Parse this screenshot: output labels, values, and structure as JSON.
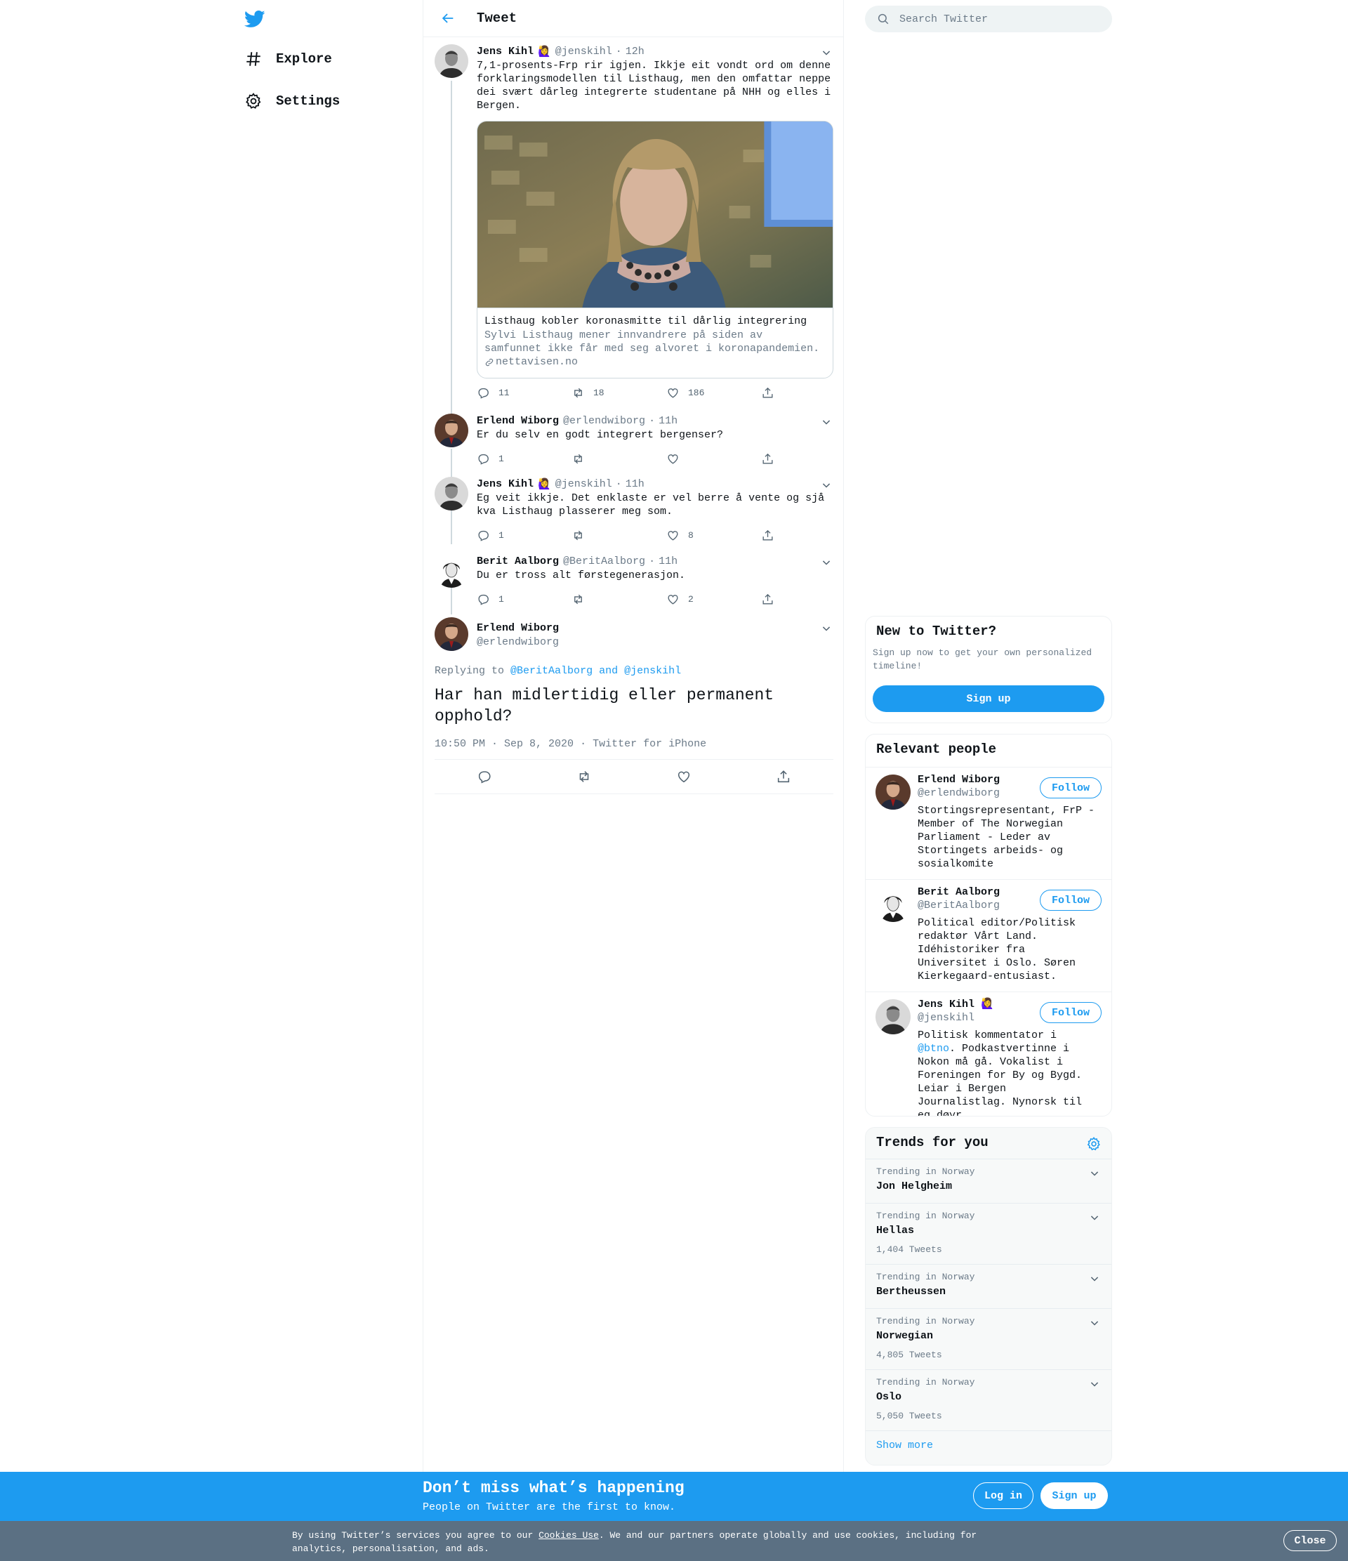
{
  "nav": {
    "logo": "twitter-bird-icon",
    "items": [
      {
        "label": "Explore",
        "icon": "hashtag-icon"
      },
      {
        "label": "Settings",
        "icon": "gear-icon"
      }
    ]
  },
  "header": {
    "title": "Tweet",
    "back_icon": "arrow-left-icon"
  },
  "thread": [
    {
      "name": "Jens Kihl",
      "emoji": "🙋‍♀️",
      "handle": "@jenskihl",
      "time": "12h",
      "text": "7,1-prosents-Frp rir igjen. Ikkje eit vondt ord om denne forklaringsmodellen til Listhaug, men den omfattar neppe dei svært dårleg integrerte studentane på NHH og elles i Bergen.",
      "card": {
        "title": "Listhaug kobler koronasmitte til dårlig integrering",
        "description": "Sylvi Listhaug mener innvandrere på siden av samfunnet ikke får med seg alvoret i koronapandemien. Lishaug …",
        "domain": "nettavisen.no"
      },
      "replies": "11",
      "retweets": "18",
      "likes": "186"
    },
    {
      "name": "Erlend Wiborg",
      "handle": "@erlendwiborg",
      "time": "11h",
      "text": "Er du selv en godt integrert bergenser?",
      "replies": "1",
      "retweets": "",
      "likes": ""
    },
    {
      "name": "Jens Kihl",
      "emoji": "🙋‍♀️",
      "handle": "@jenskihl",
      "time": "11h",
      "text": "Eg veit ikkje. Det enklaste er vel berre å vente og sjå kva Listhaug plasserer meg som.",
      "replies": "1",
      "retweets": "",
      "likes": "8"
    },
    {
      "name": "Berit Aalborg",
      "handle": "@BeritAalborg",
      "time": "11h",
      "text": "Du er tross alt førstegenerasjon.",
      "replies": "1",
      "retweets": "",
      "likes": "2"
    }
  ],
  "focus": {
    "name": "Erlend Wiborg",
    "handle": "@erlendwiborg",
    "replying_prefix": "Replying to",
    "replying_to": "@BeritAalborg and @jenskihl",
    "text": "Har han midlertidig eller permanent opphold?",
    "time": "10:50 PM",
    "date": "Sep 8, 2020",
    "source": "Twitter for iPhone"
  },
  "search": {
    "placeholder": "Search Twitter"
  },
  "new_to_twitter": {
    "title": "New to Twitter?",
    "text": "Sign up now to get your own personalized timeline!",
    "button": "Sign up"
  },
  "relevant": {
    "title": "Relevant people",
    "follow_label": "Follow",
    "people": [
      {
        "name": "Erlend Wiborg",
        "handle": "@erlendwiborg",
        "bio": "Stortingsrepresentant, FrP - Member of The Norwegian Parliament - Leder av Stortingets arbeids- og sosialkomite"
      },
      {
        "name": "Berit Aalborg",
        "handle": "@BeritAalborg",
        "bio": "Political editor/Politisk redaktør Vårt Land. Idéhistoriker fra Universitet i Oslo. Søren Kierkegaard-entusiast."
      },
      {
        "name": "Jens Kihl",
        "emoji": "🙋‍♀️",
        "handle": "@jenskihl",
        "bio_before": "Politisk kommentator i ",
        "bio_mention": "@btno",
        "bio_after": ". Podkastvertinne i Nokon må gå. Vokalist i Foreningen for By og Bygd. Leiar i Bergen Journalistlag. Nynorsk til eg døyr."
      }
    ]
  },
  "trends": {
    "title": "Trends for you",
    "items": [
      {
        "context": "Trending in Norway",
        "name": "Jon Helgheim",
        "count": ""
      },
      {
        "context": "Trending in Norway",
        "name": "Hellas",
        "count": "1,404 Tweets"
      },
      {
        "context": "Trending in Norway",
        "name": "Bertheussen",
        "count": ""
      },
      {
        "context": "Trending in Norway",
        "name": "Norwegian",
        "count": "4,805 Tweets"
      },
      {
        "context": "Trending in Norway",
        "name": "Oslo",
        "count": "5,050 Tweets"
      }
    ],
    "show_more": "Show more"
  },
  "banner": {
    "title": "Don’t miss what’s happening",
    "subtitle": "People on Twitter are the first to know.",
    "login": "Log in",
    "signup": "Sign up"
  },
  "cookie": {
    "before": "By using Twitter’s services you agree to our ",
    "link": "Cookies Use",
    "after": ". We and our partners operate globally and use cookies, including for analytics, personalisation, and ads.",
    "close": "Close"
  },
  "colors": {
    "accent": "#1d9bf0",
    "banner": "#1d9bf0",
    "cookie_bar": "#5b7083"
  }
}
